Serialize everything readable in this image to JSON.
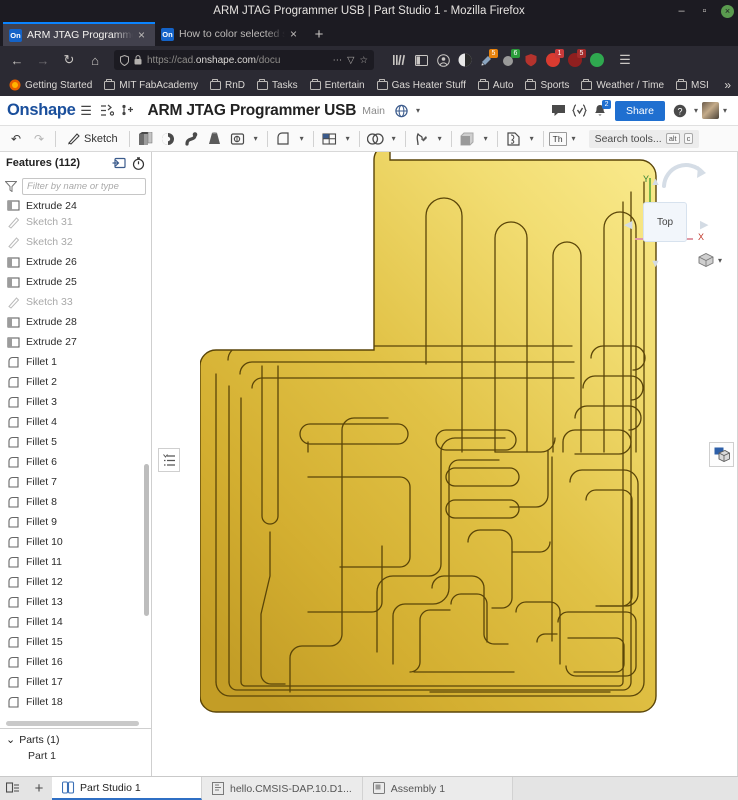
{
  "browser": {
    "window_title": "ARM JTAG Programmer USB | Part Studio 1 - Mozilla Firefox",
    "window_controls": {
      "minimize": "–",
      "maximize": "▫",
      "close": "×"
    },
    "tabs": [
      {
        "favicon_text": "On",
        "label": "ARM JTAG Programmer US",
        "close": "×",
        "active": true
      },
      {
        "favicon_text": "On",
        "label": "How to color selected surf",
        "close": "×",
        "active": false
      }
    ],
    "newtab_label": "+",
    "nav": {
      "back": "←",
      "forward": "→",
      "reload": "↻",
      "home": "⌂",
      "shield_icon": "shield",
      "lock_icon": "lock",
      "url_prefix": "https://cad.",
      "url_domain": "onshape.com",
      "url_suffix": "/docu",
      "page_actions": "⋯",
      "reader_icon": "▽",
      "bookmark_star": "☆",
      "library_icon": "library",
      "sidebar_icon": "sidebar",
      "account_icon": "account",
      "menu_icon": "☰"
    },
    "extensions": [
      {
        "name": "ublock-origin-extension",
        "badge": "",
        "color": "#8c8c8c"
      },
      {
        "name": "notes-extension",
        "badge": "5",
        "badge_color": "#e8820c",
        "color": "#b8b8b8"
      },
      {
        "name": "translate-extension",
        "badge": "6",
        "badge_color": "#2a9c3a",
        "color": "#9a9a9a"
      },
      {
        "name": "shield-extension",
        "badge": "",
        "color": "#b5332d"
      },
      {
        "name": "red-circle-extension",
        "badge": "1",
        "badge_color": "#c93a3a",
        "color": "#d93b30"
      },
      {
        "name": "dark-red-extension",
        "badge": "5",
        "badge_color": "#a32a2a",
        "color": "#8f1f1f"
      },
      {
        "name": "green-extension",
        "badge": "",
        "color": "#2fa84f"
      }
    ],
    "bookmarks": [
      {
        "label": "Getting Started",
        "icon": "firefox-icon"
      },
      {
        "label": "MIT FabAcademy",
        "icon": "folder-icon"
      },
      {
        "label": "RnD",
        "icon": "folder-icon"
      },
      {
        "label": "Tasks",
        "icon": "folder-icon"
      },
      {
        "label": "Entertain",
        "icon": "folder-icon"
      },
      {
        "label": "Gas Heater Stuff",
        "icon": "folder-icon"
      },
      {
        "label": "Auto",
        "icon": "folder-icon"
      },
      {
        "label": "Sports",
        "icon": "folder-icon"
      },
      {
        "label": "Weather / Time",
        "icon": "folder-icon"
      },
      {
        "label": "MSI",
        "icon": "folder-icon"
      }
    ],
    "bookmarks_overflow": "»"
  },
  "onshape": {
    "logo": "Onshape",
    "header_icons": {
      "menu": "☰",
      "document_menu": "document-menu",
      "versions": "versions"
    },
    "document_title": "ARM JTAG Programmer USB",
    "branch": "Main",
    "globe_label": "globe-dropdown",
    "comment_icon": "comment",
    "validate_icon": "validate",
    "notifications_count": "2",
    "share_label": "Share",
    "help_icon": "?",
    "account_avatar": "avatar"
  },
  "toolbar": {
    "undo": "↶",
    "redo": "↷",
    "sketch_label": "Sketch",
    "tools": [
      {
        "name": "extrude-tool",
        "has_chevron": false
      },
      {
        "name": "revolve-tool",
        "has_chevron": false
      },
      {
        "name": "sweep-tool",
        "has_chevron": false
      },
      {
        "name": "loft-tool",
        "has_chevron": false
      },
      {
        "name": "hole-tool",
        "has_chevron": true
      },
      {
        "name": "fillet-tool",
        "has_chevron": true
      },
      {
        "name": "rib-pattern-tool",
        "has_chevron": true
      },
      {
        "name": "boolean-tool",
        "has_chevron": true
      },
      {
        "name": "draft-tool",
        "has_chevron": true
      },
      {
        "name": "shell-tool",
        "has_chevron": true
      },
      {
        "name": "transform-tool",
        "has_chevron": true
      }
    ],
    "thickness_label": "Th",
    "search_placeholder": "Search tools...",
    "search_shortcut_alt": "alt",
    "search_shortcut_key": "c"
  },
  "feature_tree": {
    "title": "Features (112)",
    "add_icon": "add-feature-icon",
    "rollback_icon": "rollback-timer-icon",
    "filter_placeholder": "Filter by name or type",
    "funnel_icon": "funnel-icon",
    "items": [
      {
        "label": "Extrude 24",
        "type": "extrude",
        "muted": false,
        "clipped": true
      },
      {
        "label": "Sketch 31",
        "type": "sketch",
        "muted": true
      },
      {
        "label": "Sketch 32",
        "type": "sketch",
        "muted": true
      },
      {
        "label": "Extrude 26",
        "type": "extrude",
        "muted": false
      },
      {
        "label": "Extrude 25",
        "type": "extrude",
        "muted": false
      },
      {
        "label": "Sketch 33",
        "type": "sketch",
        "muted": true
      },
      {
        "label": "Extrude 28",
        "type": "extrude",
        "muted": false
      },
      {
        "label": "Extrude 27",
        "type": "extrude",
        "muted": false
      },
      {
        "label": "Fillet 1",
        "type": "fillet",
        "muted": false
      },
      {
        "label": "Fillet 2",
        "type": "fillet",
        "muted": false
      },
      {
        "label": "Fillet 3",
        "type": "fillet",
        "muted": false
      },
      {
        "label": "Fillet 4",
        "type": "fillet",
        "muted": false
      },
      {
        "label": "Fillet 5",
        "type": "fillet",
        "muted": false
      },
      {
        "label": "Fillet 6",
        "type": "fillet",
        "muted": false
      },
      {
        "label": "Fillet 7",
        "type": "fillet",
        "muted": false
      },
      {
        "label": "Fillet 8",
        "type": "fillet",
        "muted": false
      },
      {
        "label": "Fillet 9",
        "type": "fillet",
        "muted": false
      },
      {
        "label": "Fillet 10",
        "type": "fillet",
        "muted": false
      },
      {
        "label": "Fillet 11",
        "type": "fillet",
        "muted": false
      },
      {
        "label": "Fillet 12",
        "type": "fillet",
        "muted": false
      },
      {
        "label": "Fillet 13",
        "type": "fillet",
        "muted": false
      },
      {
        "label": "Fillet 14",
        "type": "fillet",
        "muted": false
      },
      {
        "label": "Fillet 15",
        "type": "fillet",
        "muted": false
      },
      {
        "label": "Fillet 16",
        "type": "fillet",
        "muted": false
      },
      {
        "label": "Fillet 17",
        "type": "fillet",
        "muted": false
      },
      {
        "label": "Fillet 18",
        "type": "fillet",
        "muted": false
      }
    ],
    "parts": {
      "header": "Parts (1)",
      "collapse_chevron": "⌄",
      "items": [
        {
          "label": "Part 1"
        }
      ]
    }
  },
  "viewport": {
    "flyout_icon": "feature-list-flyout-icon",
    "right_panel_icon": "display-panel-icon",
    "view_cube": {
      "face_label": "Top",
      "x_axis_label": "X",
      "y_axis_label": "Y",
      "x_axis_color": "#c0392b",
      "y_axis_color": "#2e7d32"
    },
    "view_selector_icon": "view-orientation-cube-icon",
    "view_selector_chevron": "▾",
    "model": {
      "name": "pcb-board-part",
      "material_color_light": "#f5e27a",
      "material_color_mid": "#e3c445",
      "material_color_dark": "#c9a22a",
      "edge_color": "#5a4508"
    }
  },
  "bottom_bar": {
    "tab_manager_icon": "tab-manager-icon",
    "add_tab_icon": "+",
    "tabs": [
      {
        "label": "Part Studio 1",
        "icon": "part-studio-icon",
        "active": true
      },
      {
        "label": "hello.CMSIS-DAP.10.D1...",
        "icon": "drawing-icon",
        "active": false
      },
      {
        "label": "Assembly 1",
        "icon": "assembly-icon",
        "active": false
      }
    ]
  }
}
